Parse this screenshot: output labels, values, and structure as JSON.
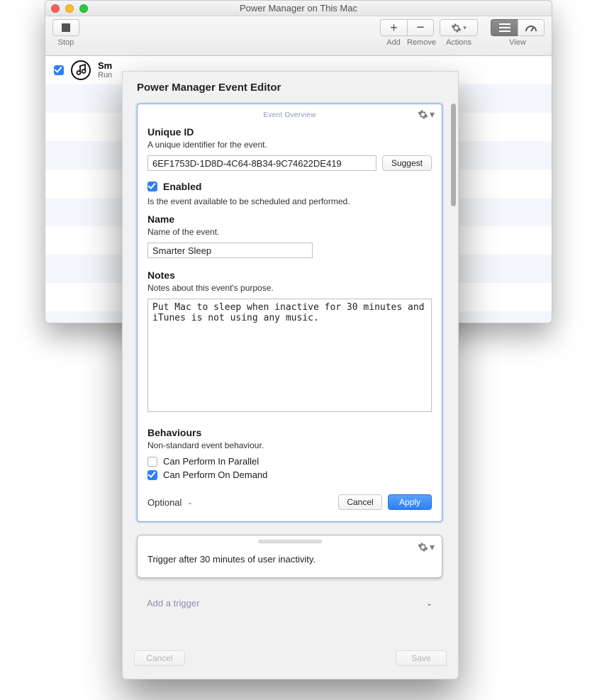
{
  "window": {
    "title": "Power Manager on This Mac"
  },
  "toolbar": {
    "stop": "Stop",
    "add": "Add",
    "remove": "Remove",
    "actions": "Actions",
    "view": "View"
  },
  "eventRow": {
    "title_partial": "Sm",
    "subtitle_partial": "Run "
  },
  "editor": {
    "title": "Power Manager Event Editor",
    "overview_label": "Event Overview",
    "uniqueId": {
      "label": "Unique ID",
      "desc": "A unique identifier for the event.",
      "value": "6EF1753D-1D8D-4C64-8B34-9C74622DE419",
      "suggest": "Suggest"
    },
    "enabled": {
      "label": "Enabled",
      "desc": "Is the event available to be scheduled and performed.",
      "checked": true
    },
    "name": {
      "label": "Name",
      "desc": "Name of the event.",
      "value": "Smarter Sleep"
    },
    "notes": {
      "label": "Notes",
      "desc": "Notes about this event's purpose.",
      "value": "Put Mac to sleep when inactive for 30 minutes and iTunes is not using any music."
    },
    "behaviours": {
      "label": "Behaviours",
      "desc": "Non-standard event behaviour.",
      "parallel_label": "Can Perform In Parallel",
      "parallel_checked": false,
      "ondemand_label": "Can Perform On Demand",
      "ondemand_checked": true
    },
    "footer": {
      "selector": "Optional",
      "cancel": "Cancel",
      "apply": "Apply"
    },
    "trigger": {
      "text": "Trigger after 30 minutes of user inactivity."
    },
    "add_trigger": "Add a trigger",
    "sheet_cancel": "Cancel",
    "sheet_save": "Save"
  }
}
